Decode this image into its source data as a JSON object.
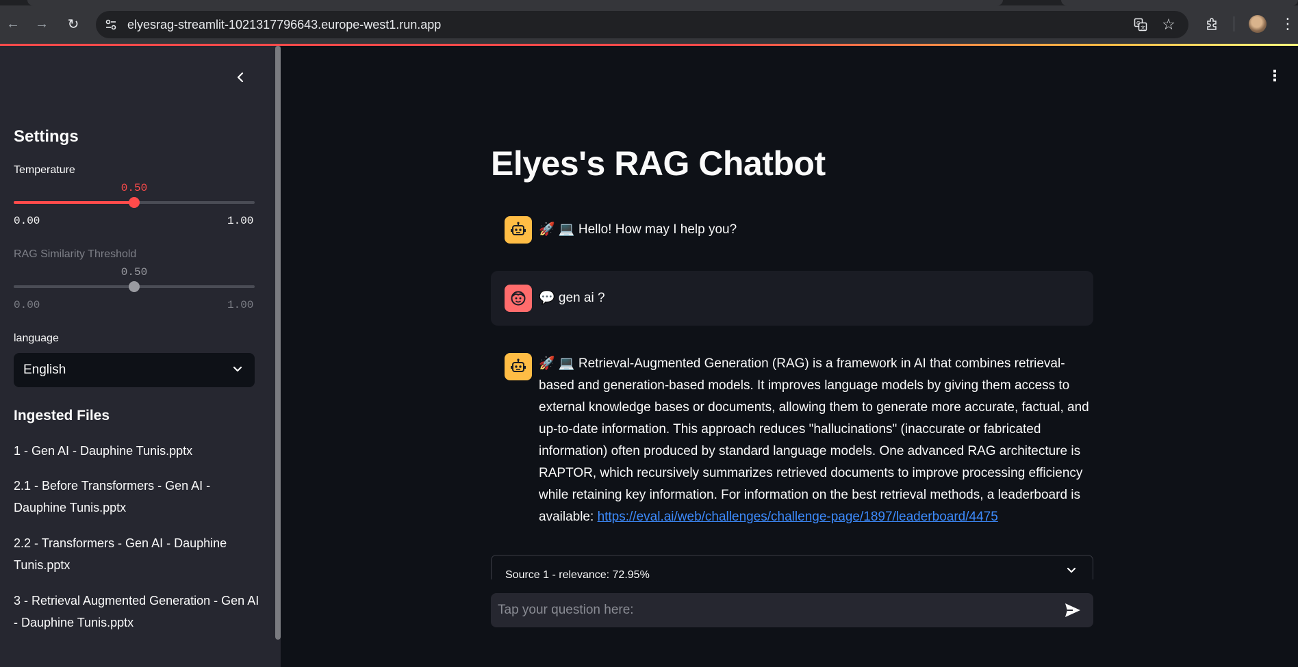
{
  "browser": {
    "url": "elyesrag-streamlit-1021317796643.europe-west1.run.app",
    "back_icon": "←",
    "forward_icon": "→",
    "reload_icon": "↻",
    "site_info_icon": "⚙",
    "translate_icon": "文",
    "star_icon": "☆",
    "extensions_icon": "⧉",
    "menu_icon": "⋮"
  },
  "sidebar": {
    "collapse_icon": "‹",
    "settings_title": "Settings",
    "temperature": {
      "label": "Temperature",
      "value": 0.5,
      "value_text": "0.50",
      "min_text": "0.00",
      "max_text": "1.00",
      "color": "#ff4b4b"
    },
    "rag_threshold": {
      "label": "RAG Similarity Threshold",
      "value": 0.5,
      "value_text": "0.50",
      "min_text": "0.00",
      "max_text": "1.00",
      "color": "#9a9ba1"
    },
    "language": {
      "label": "language",
      "selected": "English",
      "chevron": "⌄"
    },
    "files_title": "Ingested Files",
    "files": [
      "1 - Gen AI - Dauphine Tunis.pptx",
      "2.1 - Before Transformers - Gen AI - Dauphine Tunis.pptx",
      "2.2 - Transformers - Gen AI - Dauphine Tunis.pptx",
      "3 - Retrieval Augmented Generation - Gen AI - Dauphine Tunis.pptx"
    ]
  },
  "main": {
    "more_icon": "⋮",
    "title": "Elyes's RAG Chatbot",
    "messages": [
      {
        "role": "assistant",
        "text": "🚀 💻 Hello! How may I help you?"
      },
      {
        "role": "user",
        "text": "💬 gen ai ?"
      },
      {
        "role": "assistant",
        "text": "🚀 💻 Retrieval-Augmented Generation (RAG) is a framework in AI that combines retrieval-based and generation-based models. It improves language models by giving them access to external knowledge bases or documents, allowing them to generate more accurate, factual, and up-to-date information. This approach reduces \"hallucinations\" (inaccurate or fabricated information) often produced by standard language models. One advanced RAG architecture is RAPTOR, which recursively summarizes retrieved documents to improve processing efficiency while retaining key information. For information on the best retrieval methods, a leaderboard is available:",
        "link": "https://eval.ai/web/challenges/challenge-page/1897/leaderboard/4475"
      }
    ],
    "source": {
      "label": "Source 1 - relevance: 72.95%",
      "chevron": "⌄"
    },
    "chat_input": {
      "placeholder": "Tap your question here:",
      "value": ""
    }
  },
  "colors": {
    "accent": "#ff4b4b",
    "bot_avatar": "#ffbd45",
    "user_avatar": "#ff6c6c",
    "link": "#3d8bfd"
  }
}
